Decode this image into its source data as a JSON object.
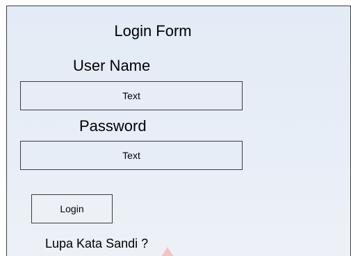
{
  "form": {
    "title": "Login Form",
    "username_label": "User Name",
    "username_placeholder": "Text",
    "password_label": "Password",
    "password_placeholder": "Text",
    "login_label": "Login",
    "forgot_label": "Lupa Kata Sandi ?"
  },
  "colors": {
    "panel_background": "#e6edf7",
    "border": "#3a3a3a",
    "text": "#000000"
  },
  "icons": {
    "watermark": "arrow-up-icon"
  }
}
